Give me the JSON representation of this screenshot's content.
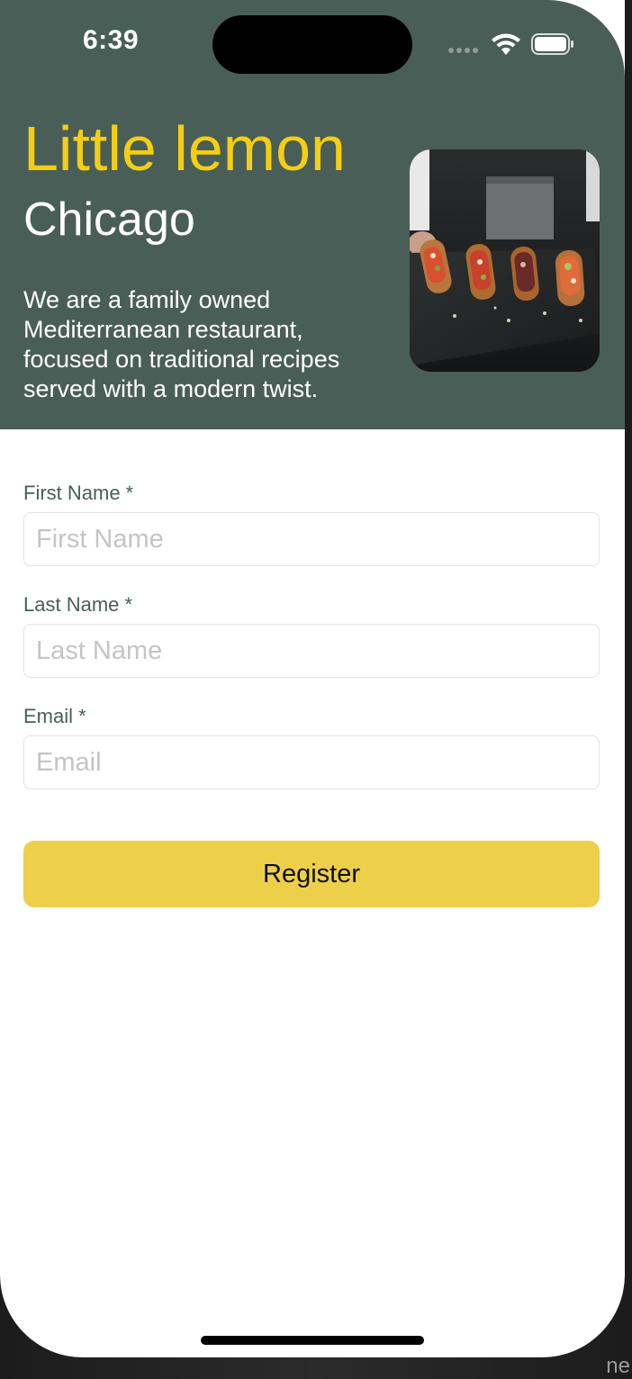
{
  "status_bar": {
    "time": "6:39",
    "icons": [
      "signal-dots-icon",
      "wifi-icon",
      "battery-icon"
    ]
  },
  "hero": {
    "title": "Little lemon",
    "subtitle": "Chicago",
    "description": "We are a family owned Mediterranean restaurant, focused on traditional recipes served with a modern twist.",
    "image": "food-platter-image"
  },
  "form": {
    "first_name": {
      "label": "First Name *",
      "placeholder": "First Name",
      "value": ""
    },
    "last_name": {
      "label": "Last Name *",
      "placeholder": "Last Name",
      "value": ""
    },
    "email": {
      "label": "Email *",
      "placeholder": "Email",
      "value": ""
    },
    "register_label": "Register"
  },
  "edge_text": "ne",
  "colors": {
    "hero_background": "#495e57",
    "title_yellow": "#f4ce14",
    "button_yellow": "#eecf49",
    "label_green": "#495e57"
  }
}
